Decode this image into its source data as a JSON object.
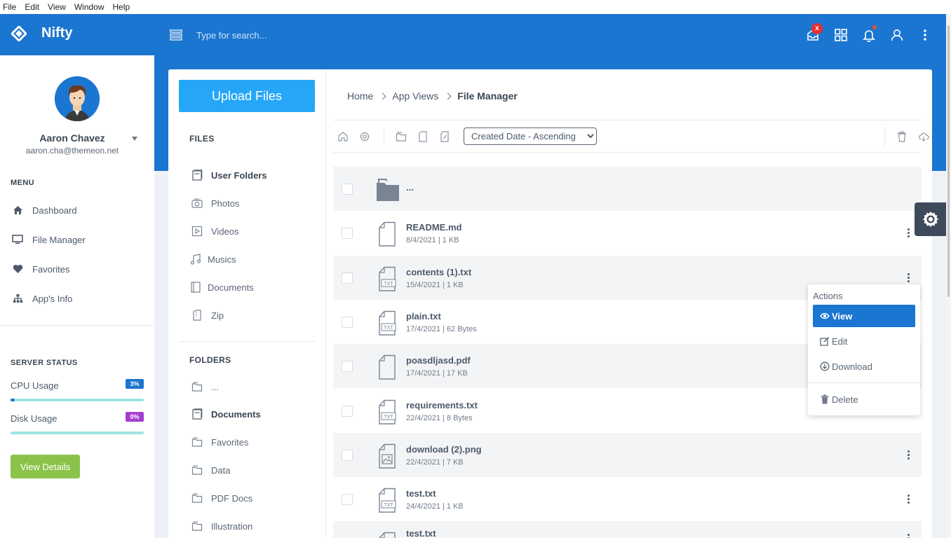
{
  "menubar": {
    "file": "File",
    "edit": "Edit",
    "view": "View",
    "window": "Window",
    "help": "Help"
  },
  "header": {
    "brand": "Nifty",
    "search_placeholder": "Type for search...",
    "notification_badge": "x",
    "colors": {
      "primary": "#1b76d1",
      "badge": "#e5312c"
    }
  },
  "sidebar": {
    "user": {
      "name": "Aaron Chavez",
      "email": "aaron.cha@themeon.net"
    },
    "menu_title": "MENU",
    "items": [
      {
        "label": "Dashboard",
        "icon": "home-icon"
      },
      {
        "label": "File Manager",
        "icon": "monitor-icon"
      },
      {
        "label": "Favorites",
        "icon": "heart-icon"
      },
      {
        "label": "App's Info",
        "icon": "sitemap-icon"
      }
    ],
    "server_status": {
      "title": "SERVER STATUS",
      "cpu": {
        "label": "CPU Usage",
        "value": "3%",
        "percent": 3,
        "color": "#1b76d1"
      },
      "disk": {
        "label": "Disk Usage",
        "value": "0%",
        "percent": 0,
        "color": "#a53ecd"
      },
      "button": "View Details"
    }
  },
  "file_panel": {
    "upload": "Upload Files",
    "files_title": "FILES",
    "files": [
      {
        "label": "User Folders",
        "icon": "folder-stack-icon",
        "active": true
      },
      {
        "label": "Photos",
        "icon": "camera-icon"
      },
      {
        "label": "Videos",
        "icon": "video-icon"
      },
      {
        "label": "Musics",
        "icon": "music-icon"
      },
      {
        "label": "Documents",
        "icon": "notebook-icon"
      },
      {
        "label": "Zip",
        "icon": "zip-icon"
      }
    ],
    "folders_title": "FOLDERS",
    "folders": [
      {
        "label": "...",
        "icon": "folder-icon"
      },
      {
        "label": "Documents",
        "icon": "folder-stack-icon",
        "active": true
      },
      {
        "label": "Favorites",
        "icon": "folder-icon"
      },
      {
        "label": "Data",
        "icon": "folder-icon"
      },
      {
        "label": "PDF Docs",
        "icon": "folder-icon"
      },
      {
        "label": "Illustration",
        "icon": "folder-icon"
      }
    ]
  },
  "breadcrumb": {
    "home": "Home",
    "app_views": "App Views",
    "current": "File Manager"
  },
  "toolbar": {
    "sort_selected": "Created Date - Ascending"
  },
  "files": [
    {
      "name": "...",
      "meta": "",
      "type": "folder"
    },
    {
      "name": "README.md",
      "meta": "8/4/2021 | 1 KB",
      "type": "blank"
    },
    {
      "name": "contents (1).txt",
      "meta": "15/4/2021 | 1 KB",
      "type": "txt"
    },
    {
      "name": "plain.txt",
      "meta": "17/4/2021 | 62 Bytes",
      "type": "txt"
    },
    {
      "name": "poasdljasd.pdf",
      "meta": "17/4/2021 | 17 KB",
      "type": "blank"
    },
    {
      "name": "requirements.txt",
      "meta": "22/4/2021 | 8 Bytes",
      "type": "txt"
    },
    {
      "name": "download (2).png",
      "meta": "22/4/2021 | 7 KB",
      "type": "image"
    },
    {
      "name": "test.txt",
      "meta": "24/4/2021 | 1 KB",
      "type": "txt"
    },
    {
      "name": "test.txt",
      "meta": "",
      "type": "txt"
    }
  ],
  "file_icon_tag": "TXT",
  "actions": {
    "title": "Actions",
    "view": "View",
    "edit": "Edit",
    "download": "Download",
    "delete": "Delete"
  }
}
